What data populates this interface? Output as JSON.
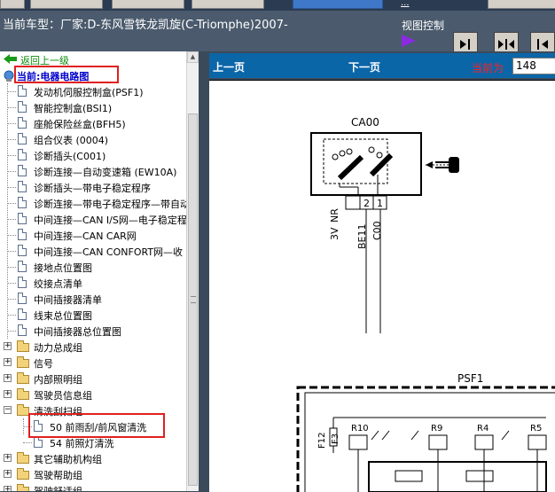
{
  "header": {
    "vehicle_label": "当前车型：厂家:D-东风雪铁龙凯旋(C-Triomphe)2007-",
    "view_control_label": "视图控制",
    "top_link": "..."
  },
  "tree": {
    "back_label": "返回上一级",
    "current_label": "当前:电器电路图",
    "items": [
      {
        "label": "发动机伺服控制盒(PSF1)",
        "type": "doc"
      },
      {
        "label": "智能控制盒(BSI1)",
        "type": "doc"
      },
      {
        "label": "座舱保险丝盒(BFH5)",
        "type": "doc"
      },
      {
        "label": "组合仪表 (0004)",
        "type": "doc"
      },
      {
        "label": "诊断插头(C001)",
        "type": "doc"
      },
      {
        "label": "诊断连接—自动变速箱 (EW10A)",
        "type": "doc"
      },
      {
        "label": "诊断插头—带电子稳定程序",
        "type": "doc"
      },
      {
        "label": "诊断连接—带电子稳定程序—带自动变",
        "type": "doc"
      },
      {
        "label": "中间连接—CAN I/S网—电子稳定程",
        "type": "doc"
      },
      {
        "label": "中间连接—CAN CAR网",
        "type": "doc"
      },
      {
        "label": "中间连接—CAN CONFORT网—收",
        "type": "doc"
      },
      {
        "label": "接地点位置图",
        "type": "doc"
      },
      {
        "label": "绞接点清单",
        "type": "doc"
      },
      {
        "label": "中间插接器清单",
        "type": "doc"
      },
      {
        "label": "线束总位置图",
        "type": "doc"
      },
      {
        "label": "中间插接器总位置图",
        "type": "doc"
      },
      {
        "label": "动力总成组",
        "type": "folder"
      },
      {
        "label": "信号",
        "type": "folder"
      },
      {
        "label": "内部照明组",
        "type": "folder"
      },
      {
        "label": "驾驶员信息组",
        "type": "folder"
      },
      {
        "label": "清洗刮扫组",
        "type": "folder-open"
      },
      {
        "label": "50 前雨刮/前风窗清洗",
        "type": "subdoc"
      },
      {
        "label": "54 前照灯清洗",
        "type": "subdoc"
      },
      {
        "label": "其它辅助机构组",
        "type": "folder"
      },
      {
        "label": "驾驶帮助组",
        "type": "folder"
      },
      {
        "label": "驾驶舒适组",
        "type": "folder"
      }
    ]
  },
  "nav": {
    "prev_label": "上一页",
    "next_label": "下一页",
    "current_page_label": "当前为",
    "current_page_value": "148"
  },
  "diagram": {
    "connector_label": "CA00",
    "module_label": "PSF1",
    "pin_labels": [
      "2",
      "1"
    ],
    "wire_labels": [
      "3V",
      "NR",
      "BE11",
      "C00"
    ],
    "fuse_labels": [
      "F12",
      "F3"
    ],
    "relay_labels": [
      "R10",
      "R9",
      "R4",
      "R5"
    ]
  },
  "colors": {
    "header_bg": "#4b5b6d",
    "nav_bar_bg": "#0b66a8",
    "highlight_red": "#e02020",
    "link_green": "#0a8a0a"
  }
}
